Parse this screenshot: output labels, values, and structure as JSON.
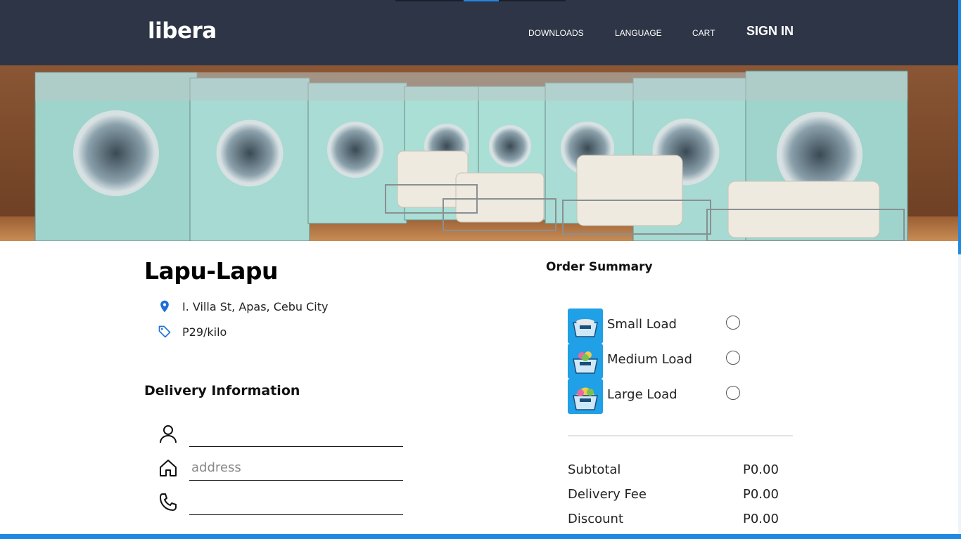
{
  "header": {
    "logo": "libera",
    "nav": [
      "DOWNLOADS",
      "LANGUAGE",
      "CART"
    ],
    "signin": "SIGN IN"
  },
  "store": {
    "name": "Lapu-Lapu",
    "address": "I. Villa St, Apas, Cebu City",
    "price": "P29/kilo",
    "icons": {
      "address": "location-pin-icon",
      "price": "price-tag-icon"
    }
  },
  "delivery": {
    "title": "Delivery Information",
    "fields": {
      "name_value": "",
      "address_placeholder": "address",
      "phone_value": ""
    },
    "icons": [
      "person-icon",
      "house-icon",
      "phone-icon"
    ]
  },
  "order": {
    "title": "Order Summary",
    "loads": [
      {
        "label": "Small Load",
        "icon": "small-load-basket-icon",
        "selected": false
      },
      {
        "label": "Medium Load",
        "icon": "medium-load-basket-icon",
        "selected": false
      },
      {
        "label": "Large Load",
        "icon": "large-load-basket-icon",
        "selected": false
      }
    ],
    "summary": [
      {
        "label": "Subtotal",
        "value": "P0.00"
      },
      {
        "label": "Delivery Fee",
        "value": "P0.00"
      },
      {
        "label": "Discount",
        "value": "P0.00"
      }
    ]
  },
  "colors": {
    "header_bg": "#2e3547",
    "accent": "#1e88e5",
    "load_icon_bg": "#20a0e6",
    "icon_blue": "#1e6fd9"
  }
}
